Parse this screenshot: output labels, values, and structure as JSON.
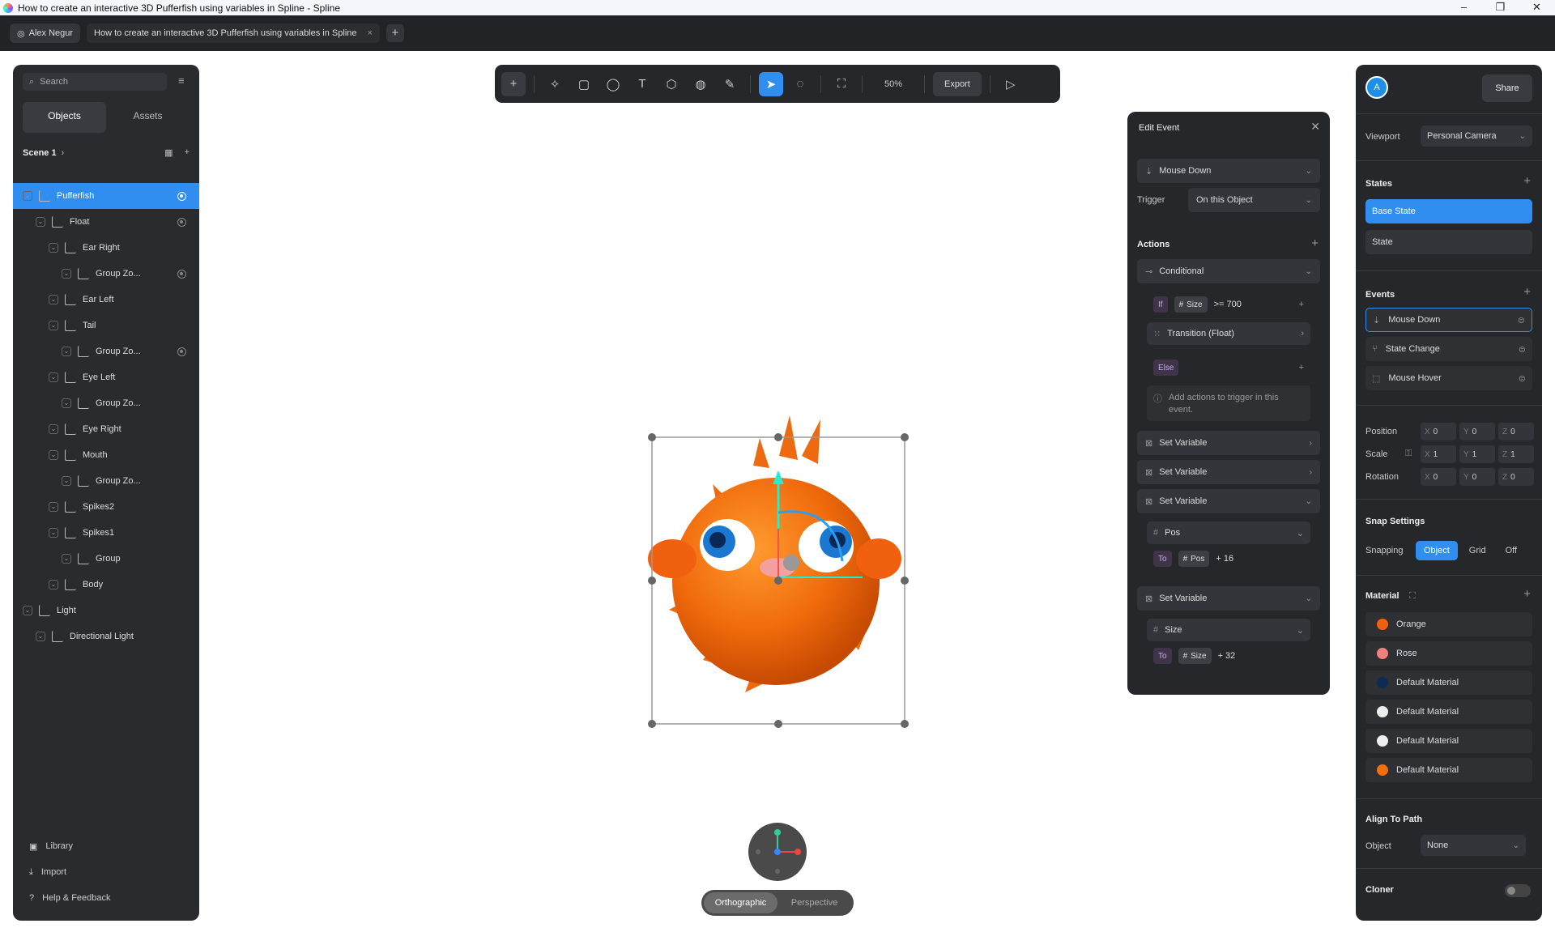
{
  "window": {
    "title": "How to create an interactive 3D Pufferfish using variables in Spline - Spline"
  },
  "tabbar": {
    "user": "Alex Negur",
    "tab_title": "How to create an interactive 3D Pufferfish using variables in Spline",
    "close": "×",
    "new_tab": "+"
  },
  "left": {
    "search_placeholder": "Search",
    "tabs": [
      "Objects",
      "Assets"
    ],
    "scene": "Scene 1",
    "tree": [
      {
        "label": "Pufferfish",
        "depth": 0,
        "selected": true,
        "eye": true
      },
      {
        "label": "Float",
        "depth": 1,
        "eye": true
      },
      {
        "label": "Ear Right",
        "depth": 2
      },
      {
        "label": "Group Zo...",
        "depth": 3,
        "eye": true
      },
      {
        "label": "Ear Left",
        "depth": 2
      },
      {
        "label": "Tail",
        "depth": 2
      },
      {
        "label": "Group Zo...",
        "depth": 3,
        "eye": true
      },
      {
        "label": "Eye Left",
        "depth": 2
      },
      {
        "label": "Group Zo...",
        "depth": 3
      },
      {
        "label": "Eye Right",
        "depth": 2
      },
      {
        "label": "Mouth",
        "depth": 2
      },
      {
        "label": "Group Zo...",
        "depth": 3
      },
      {
        "label": "Spikes2",
        "depth": 2
      },
      {
        "label": "Spikes1",
        "depth": 2
      },
      {
        "label": "Group",
        "depth": 3
      },
      {
        "label": "Body",
        "depth": 2
      },
      {
        "label": "Light",
        "depth": 0
      },
      {
        "label": "Directional Light",
        "depth": 1
      }
    ],
    "footer": [
      "Library",
      "Import",
      "Help & Feedback"
    ]
  },
  "toolbar": {
    "zoom": "50%",
    "export": "Export"
  },
  "edit_event": {
    "title": "Edit Event",
    "event": "Mouse Down",
    "trigger_label": "Trigger",
    "trigger_value": "On this Object",
    "actions_label": "Actions",
    "conditional": "Conditional",
    "if_label": "If",
    "if_var": "Size",
    "if_op": ">= 700",
    "transition": "Transition (Float)",
    "else_label": "Else",
    "else_hint": "Add actions to trigger in this event.",
    "set_variable": "Set Variable",
    "var1": "Pos",
    "to_label": "To",
    "var1_expr": "+ 16",
    "var2": "Size",
    "var2_expr": "+ 32"
  },
  "right": {
    "avatar": "A",
    "share": "Share",
    "viewport_label": "Viewport",
    "viewport_value": "Personal Camera",
    "states_label": "States",
    "states": [
      "Base State",
      "State"
    ],
    "events_label": "Events",
    "events": [
      "Mouse Down",
      "State Change",
      "Mouse Hover"
    ],
    "position_label": "Position",
    "scale_label": "Scale",
    "rotation_label": "Rotation",
    "position": [
      "0",
      "0",
      "0"
    ],
    "scale": [
      "1",
      "1",
      "1"
    ],
    "rotation": [
      "0",
      "0",
      "0"
    ],
    "snap_label": "Snap Settings",
    "snapping_label": "Snapping",
    "snap_options": [
      "Object",
      "Grid",
      "Off"
    ],
    "material_label": "Material",
    "materials": [
      {
        "name": "Orange",
        "color": "#f0600e"
      },
      {
        "name": "Rose",
        "color": "#f08080"
      },
      {
        "name": "Default Material",
        "color": "#0e2a55"
      },
      {
        "name": "Default Material",
        "color": "#eeeeee"
      },
      {
        "name": "Default Material",
        "color": "#eeeeee"
      },
      {
        "name": "Default Material",
        "color": "#f07010"
      }
    ],
    "align_label": "Align To Path",
    "object_label": "Object",
    "object_value": "None",
    "cloner_label": "Cloner"
  },
  "viewport": {
    "projection": [
      "Orthographic",
      "Perspective"
    ]
  }
}
